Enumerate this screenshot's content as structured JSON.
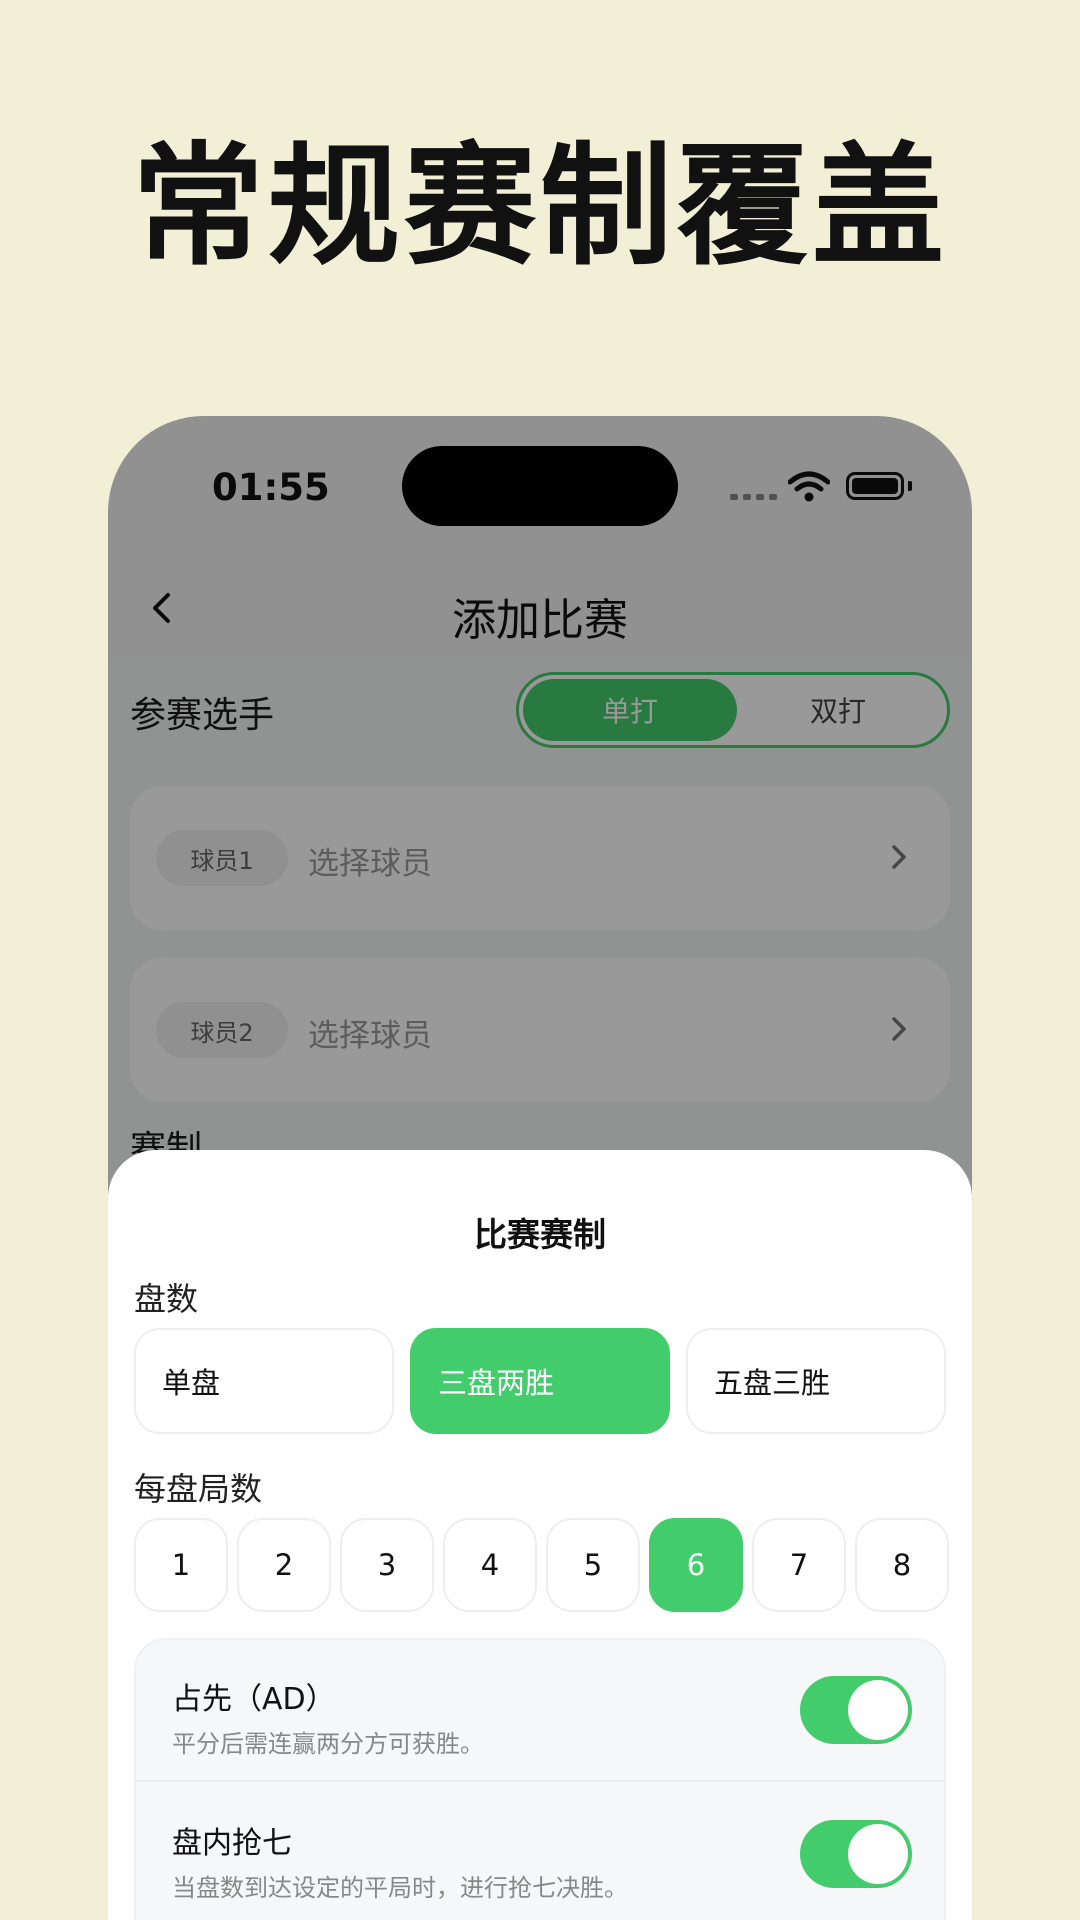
{
  "headline": "常规赛制覆盖",
  "status": {
    "time": "01:55"
  },
  "nav": {
    "title": "添加比赛",
    "back_icon": "chevron-left-icon"
  },
  "players": {
    "section_title": "参赛选手",
    "mode_options": [
      "单打",
      "双打"
    ],
    "mode_selected": "单打",
    "player1_tag": "球员1",
    "player2_tag": "球员2",
    "select_placeholder": "选择球员"
  },
  "format_section_title": "赛制",
  "sheet": {
    "title": "比赛赛制",
    "sets_label": "盘数",
    "set_options": [
      "单盘",
      "三盘两胜",
      "五盘三胜"
    ],
    "set_selected": "三盘两胜",
    "games_label": "每盘局数",
    "game_options": [
      "1",
      "2",
      "3",
      "4",
      "5",
      "6",
      "7",
      "8"
    ],
    "game_selected": "6",
    "toggles": [
      {
        "title": "占先（AD）",
        "desc": "平分后需连赢两分方可获胜。",
        "on": true
      },
      {
        "title": "盘内抢七",
        "desc": "当盘数到达设定的平局时，进行抢七决胜。",
        "on": true
      }
    ]
  },
  "colors": {
    "accent": "#43cc6b",
    "background": "#f1efd6"
  }
}
